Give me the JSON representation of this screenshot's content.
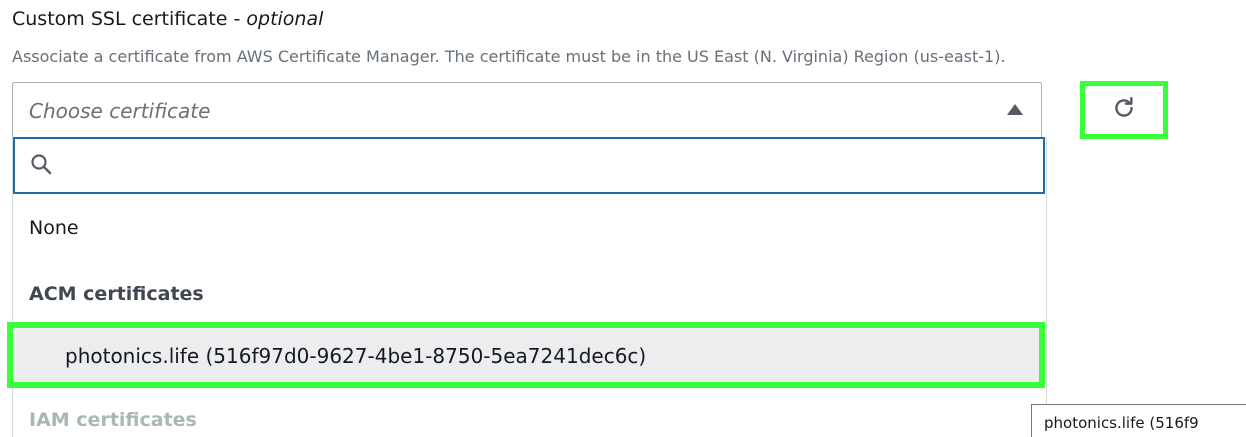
{
  "field": {
    "label": "Custom SSL certificate - ",
    "label_optional": "optional",
    "description": "Associate a certificate from AWS Certificate Manager. The certificate must be in the US East (N. Virginia) Region (us-east-1)."
  },
  "select": {
    "placeholder": "Choose certificate",
    "caret_icon": "caret-up-icon",
    "search_placeholder": ""
  },
  "refresh": {
    "icon": "refresh-icon",
    "highlight_color": "#39ff3a"
  },
  "options": {
    "none_label": "None",
    "acm_group_label": "ACM certificates",
    "acm_items": [
      {
        "label": "photonics.life (516f97d0-9627-4be1-8750-5ea7241dec6c)"
      }
    ],
    "iam_group_label": "IAM certificates"
  },
  "tooltip": {
    "text": "photonics.life (516f9"
  },
  "colors": {
    "focus_border": "#1b6ea8",
    "highlight": "#39ff3a",
    "selected_bg": "#ecedee"
  }
}
